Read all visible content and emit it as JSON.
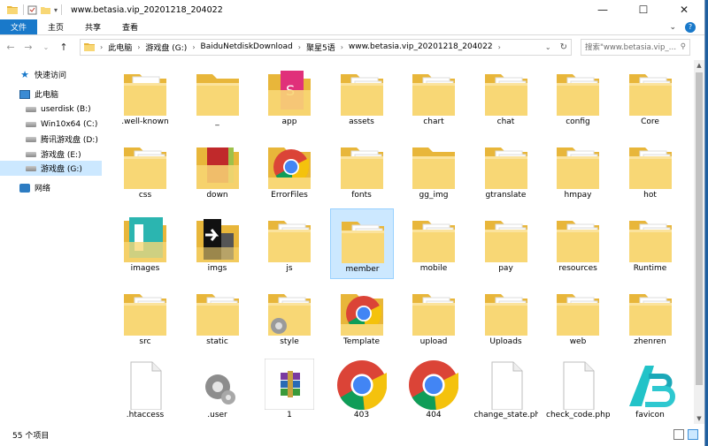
{
  "window": {
    "title": "www.betasia.vip_20201218_204022",
    "controls": [
      "—",
      "☐",
      "✕"
    ]
  },
  "ribbon": {
    "tabs": [
      "文件",
      "主页",
      "共享",
      "查看"
    ]
  },
  "address": {
    "crumbs": [
      "此电脑",
      "游戏盘 (G:)",
      "BaiduNetdiskDownload",
      "聚星5语",
      "www.betasia.vip_20201218_204022"
    ],
    "search_placeholder": "搜索\"www.betasia.vip_2020..."
  },
  "nav": {
    "items": [
      {
        "label": "快速访问",
        "icon": "star-icon"
      },
      {
        "label": "此电脑",
        "icon": "computer-icon"
      },
      {
        "label": "userdisk (B:)",
        "icon": "drive-icon"
      },
      {
        "label": "Win10x64 (C:)",
        "icon": "drive-icon"
      },
      {
        "label": "腾讯游戏盘 (D:)",
        "icon": "drive-icon"
      },
      {
        "label": "游戏盘 (E:)",
        "icon": "drive-icon"
      },
      {
        "label": "游戏盘 (G:)",
        "icon": "drive-icon"
      },
      {
        "label": "网络",
        "icon": "network-icon"
      }
    ]
  },
  "files": [
    {
      "name": ".well-known",
      "type": "folder"
    },
    {
      "name": "_",
      "type": "folder-empty"
    },
    {
      "name": "app",
      "type": "folder-pink"
    },
    {
      "name": "assets",
      "type": "folder-docs"
    },
    {
      "name": "chart",
      "type": "folder-docs"
    },
    {
      "name": "chat",
      "type": "folder-docs"
    },
    {
      "name": "config",
      "type": "folder-docs"
    },
    {
      "name": "Core",
      "type": "folder-docs"
    },
    {
      "name": "css",
      "type": "folder-docs"
    },
    {
      "name": "down",
      "type": "folder-red"
    },
    {
      "name": "ErrorFiles",
      "type": "folder-chrome"
    },
    {
      "name": "fonts",
      "type": "folder-docs"
    },
    {
      "name": "gg_img",
      "type": "folder-empty"
    },
    {
      "name": "gtranslate",
      "type": "folder-docs"
    },
    {
      "name": "hmpay",
      "type": "folder-docs"
    },
    {
      "name": "hot",
      "type": "folder-docs"
    },
    {
      "name": "images",
      "type": "folder-teal"
    },
    {
      "name": "imgs",
      "type": "folder-arrow"
    },
    {
      "name": "js",
      "type": "folder-docs"
    },
    {
      "name": "member",
      "type": "folder-docs"
    },
    {
      "name": "mobile",
      "type": "folder-docs"
    },
    {
      "name": "pay",
      "type": "folder-docs"
    },
    {
      "name": "resources",
      "type": "folder-docs"
    },
    {
      "name": "Runtime",
      "type": "folder-docs"
    },
    {
      "name": "src",
      "type": "folder-docs"
    },
    {
      "name": "static",
      "type": "folder-docs"
    },
    {
      "name": "style",
      "type": "folder-gear"
    },
    {
      "name": "Template",
      "type": "folder-chrome"
    },
    {
      "name": "upload",
      "type": "folder-docs"
    },
    {
      "name": "Uploads",
      "type": "folder-docs"
    },
    {
      "name": "web",
      "type": "folder-docs"
    },
    {
      "name": "zhenren",
      "type": "folder-docs"
    },
    {
      "name": ".htaccess",
      "type": "file-blank"
    },
    {
      "name": ".user",
      "type": "file-gear"
    },
    {
      "name": "1",
      "type": "file-rar"
    },
    {
      "name": "403",
      "type": "file-chrome"
    },
    {
      "name": "404",
      "type": "file-chrome"
    },
    {
      "name": "change_state.ph",
      "type": "file-blank"
    },
    {
      "name": "check_code.php",
      "type": "file-blank"
    },
    {
      "name": "favicon",
      "type": "file-logo"
    }
  ],
  "selected_file": "member",
  "status": {
    "count_text": "55 个项目"
  },
  "colors": {
    "accent": "#1979ca",
    "folder": "#f8d775",
    "selection": "#cce8ff"
  }
}
